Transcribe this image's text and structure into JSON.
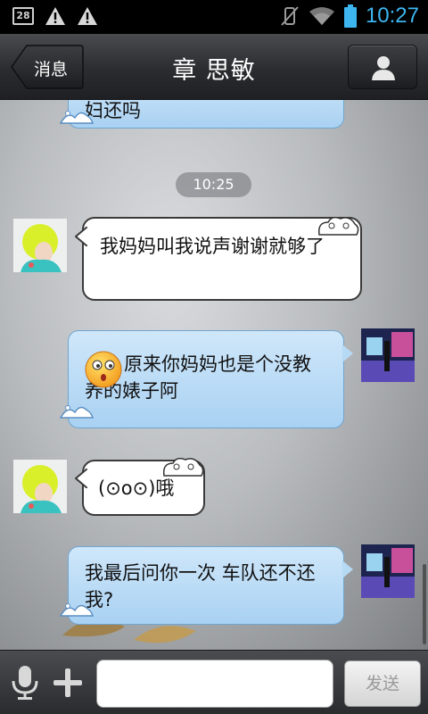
{
  "status_bar": {
    "badge": "28",
    "time": "10:27"
  },
  "header": {
    "back_label": "消息",
    "title": "章  思敏"
  },
  "chat": {
    "top_partial_text": "妇还吗",
    "timestamp": "10:25",
    "messages": [
      {
        "side": "left",
        "text": "我妈妈叫我说声谢谢就够了"
      },
      {
        "side": "right",
        "emoji": "surprised-face-emoji",
        "text": "原来你妈妈也是个没教养的婊子阿"
      },
      {
        "side": "left",
        "text": "(⊙o⊙)哦"
      },
      {
        "side": "right",
        "text": "我最后问你一次 车队还不还我?"
      }
    ]
  },
  "input_bar": {
    "placeholder": "",
    "send_label": "发送"
  },
  "colors": {
    "accent_blue": "#3db6f0",
    "right_bubble": "#b8dbf5",
    "left_bubble": "#ffffff"
  }
}
